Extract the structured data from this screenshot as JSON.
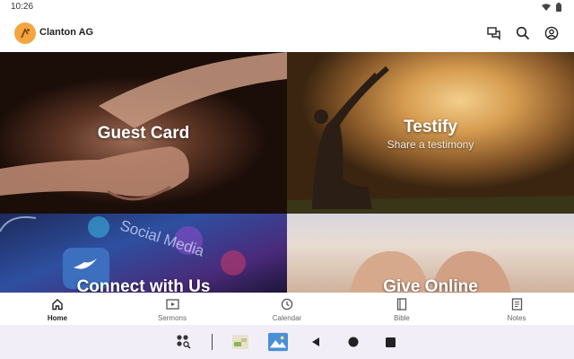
{
  "status_bar": {
    "time": "10:26"
  },
  "header": {
    "title": "Clanton AG"
  },
  "tiles": {
    "guest": {
      "title": "Guest Card"
    },
    "testify": {
      "title": "Testify",
      "subtitle": "Share a testimony"
    },
    "connect": {
      "title": "Connect with Us",
      "image_text": "Social Media"
    },
    "give": {
      "title": "Give Online"
    }
  },
  "nav": {
    "items": [
      {
        "label": "Home",
        "icon": "home-icon",
        "active": true
      },
      {
        "label": "Sermons",
        "icon": "play-icon"
      },
      {
        "label": "Calendar",
        "icon": "clock-icon"
      },
      {
        "label": "Bible",
        "icon": "book-icon"
      },
      {
        "label": "Notes",
        "icon": "notes-icon"
      }
    ]
  },
  "colors": {
    "accent": "#f2a541",
    "system_bar": "#f2eef8"
  }
}
